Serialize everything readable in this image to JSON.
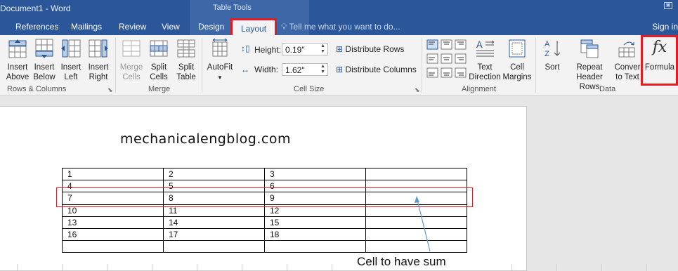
{
  "titlebar": {
    "doc_title": "Document1 - Word",
    "context_label": "Table Tools"
  },
  "tabs": {
    "references": "References",
    "mailings": "Mailings",
    "review": "Review",
    "view": "View",
    "design": "Design",
    "layout": "Layout",
    "tell_me": "Tell me what you want to do...",
    "sign_in": "Sign in"
  },
  "ribbon": {
    "rows_columns": {
      "insert_above": [
        "Insert",
        "Above"
      ],
      "insert_below": [
        "Insert",
        "Below"
      ],
      "insert_left": [
        "Insert",
        "Left"
      ],
      "insert_right": [
        "Insert",
        "Right"
      ],
      "label": "Rows & Columns"
    },
    "merge": {
      "merge_cells": [
        "Merge",
        "Cells"
      ],
      "split_cells": [
        "Split",
        "Cells"
      ],
      "split_table": [
        "Split",
        "Table"
      ],
      "label": "Merge"
    },
    "cell_size": {
      "autofit": "AutoFit",
      "height_label": "Height:",
      "height_value": "0.19\"",
      "width_label": "Width:",
      "width_value": "1.62\"",
      "distribute_rows": "Distribute Rows",
      "distribute_columns": "Distribute Columns",
      "label": "Cell Size"
    },
    "alignment": {
      "text_direction": [
        "Text",
        "Direction"
      ],
      "cell_margins": [
        "Cell",
        "Margins"
      ],
      "label": "Alignment"
    },
    "data": {
      "sort": "Sort",
      "repeat_header_rows": [
        "Repeat",
        "Header Rows"
      ],
      "convert_to_text": [
        "Conver",
        "to Text"
      ],
      "formula": "Formula",
      "label": "Data"
    }
  },
  "document": {
    "heading": "mechanicalengblog.com",
    "table_rows": [
      [
        "1",
        "2",
        "3",
        ""
      ],
      [
        "4",
        "5",
        "6",
        ""
      ],
      [
        "7",
        "8",
        "9",
        ""
      ],
      [
        "10",
        "11",
        "12",
        ""
      ],
      [
        "13",
        "14",
        "15",
        ""
      ],
      [
        "16",
        "17",
        "18",
        ""
      ],
      [
        "",
        "",
        "",
        ""
      ]
    ],
    "annotation": "Cell to have sum"
  },
  "colors": {
    "accent": "#2b579a",
    "highlight": "#e21b25",
    "arrow": "#5b9bd5"
  }
}
